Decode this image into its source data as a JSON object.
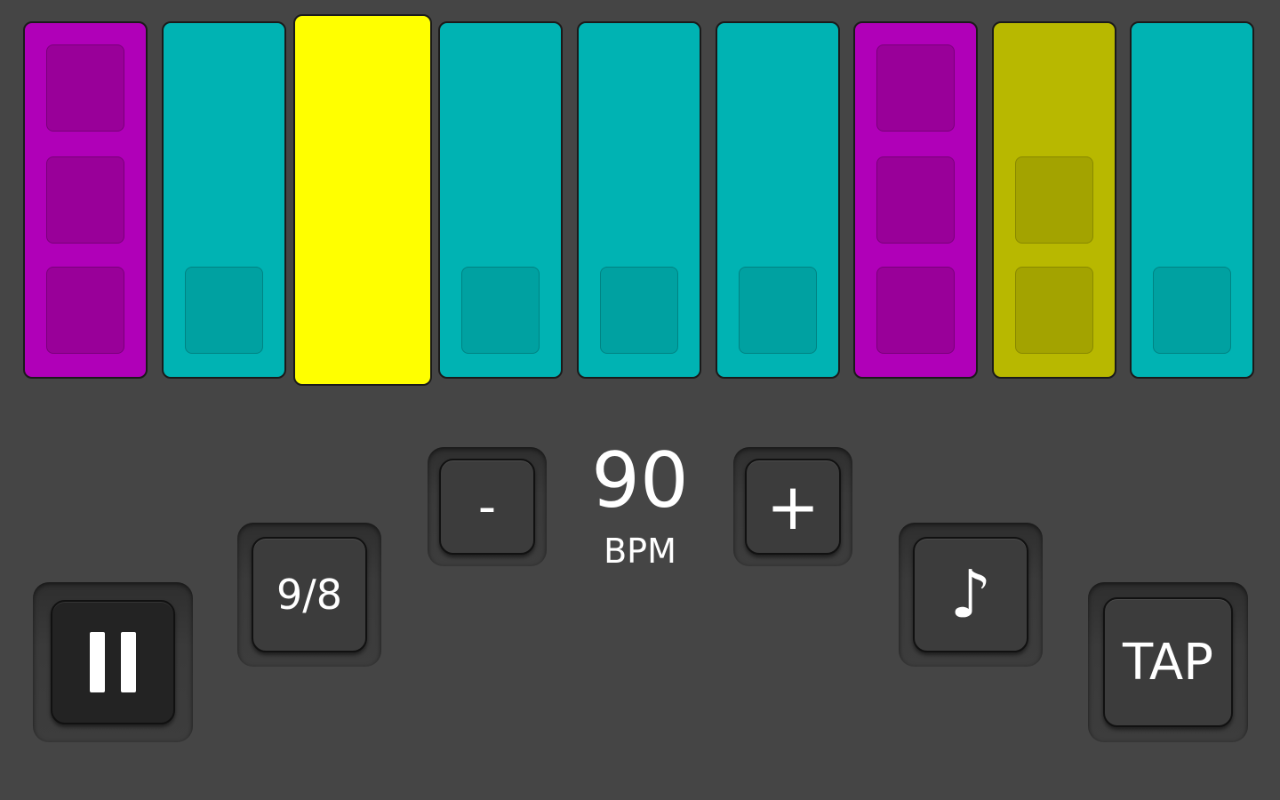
{
  "beats": [
    {
      "type": "accent",
      "active": false,
      "levels": 3
    },
    {
      "type": "normal",
      "active": false,
      "levels": 1
    },
    {
      "type": "sub",
      "active": true,
      "levels": 2
    },
    {
      "type": "normal",
      "active": false,
      "levels": 1
    },
    {
      "type": "normal",
      "active": false,
      "levels": 1
    },
    {
      "type": "normal",
      "active": false,
      "levels": 1
    },
    {
      "type": "accent",
      "active": false,
      "levels": 3
    },
    {
      "type": "sub",
      "active": false,
      "levels": 2
    },
    {
      "type": "normal",
      "active": false,
      "levels": 1
    }
  ],
  "colors": {
    "accent": "#b000b8",
    "normal": "#00b3b3",
    "sub": "#b8b800",
    "active": "#ffff00",
    "background": "#454545"
  },
  "tempo": {
    "bpm": "90",
    "unit_label": "BPM",
    "decrease_label": "-",
    "increase_label": "+"
  },
  "controls": {
    "play_state": "playing",
    "pause_icon": "pause-icon",
    "time_signature_label": "9/8",
    "note_value_label": "♪",
    "tap_label": "TAP"
  }
}
